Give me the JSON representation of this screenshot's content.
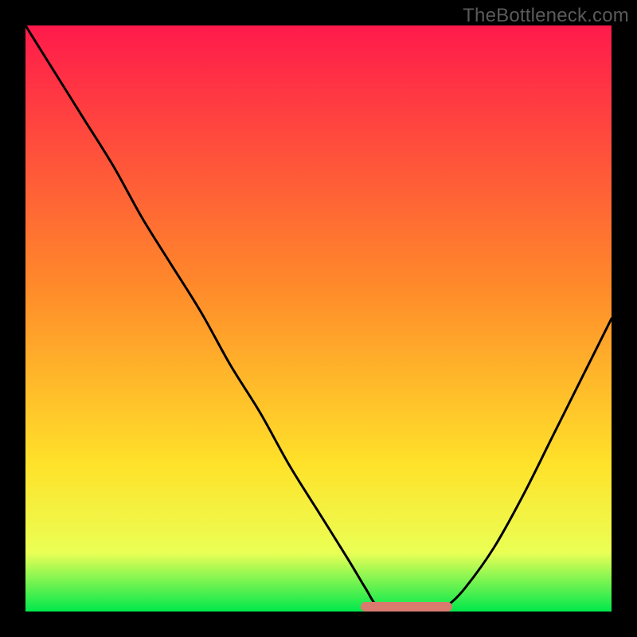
{
  "watermark": "TheBottleneck.com",
  "colors": {
    "frame": "#000000",
    "curve": "#000000",
    "highlight": "#d97a6f",
    "gradient_top": "#ff1a4b",
    "gradient_mid1": "#ff8b2a",
    "gradient_mid2": "#ffe22a",
    "gradient_yellowgreen": "#eaff55",
    "gradient_bottom": "#00e84c"
  },
  "chart_data": {
    "type": "line",
    "title": "",
    "xlabel": "",
    "ylabel": "",
    "xlim": [
      0,
      100
    ],
    "ylim": [
      0,
      100
    ],
    "x": [
      0,
      5,
      10,
      15,
      20,
      25,
      30,
      35,
      40,
      45,
      50,
      55,
      58,
      60,
      63,
      66,
      70,
      72,
      75,
      80,
      85,
      90,
      95,
      100
    ],
    "values": [
      100,
      92,
      84,
      76,
      67,
      59,
      51,
      42,
      34,
      25,
      17,
      9,
      4,
      1,
      0,
      0,
      0,
      1,
      4,
      11,
      20,
      30,
      40,
      50
    ],
    "highlight_segment": {
      "x_start": 58,
      "x_end": 72,
      "y": 0
    },
    "gradient_stops_pct": {
      "red": 0,
      "orange": 45,
      "yellow": 75,
      "yellowgreen": 90,
      "green": 100
    }
  }
}
